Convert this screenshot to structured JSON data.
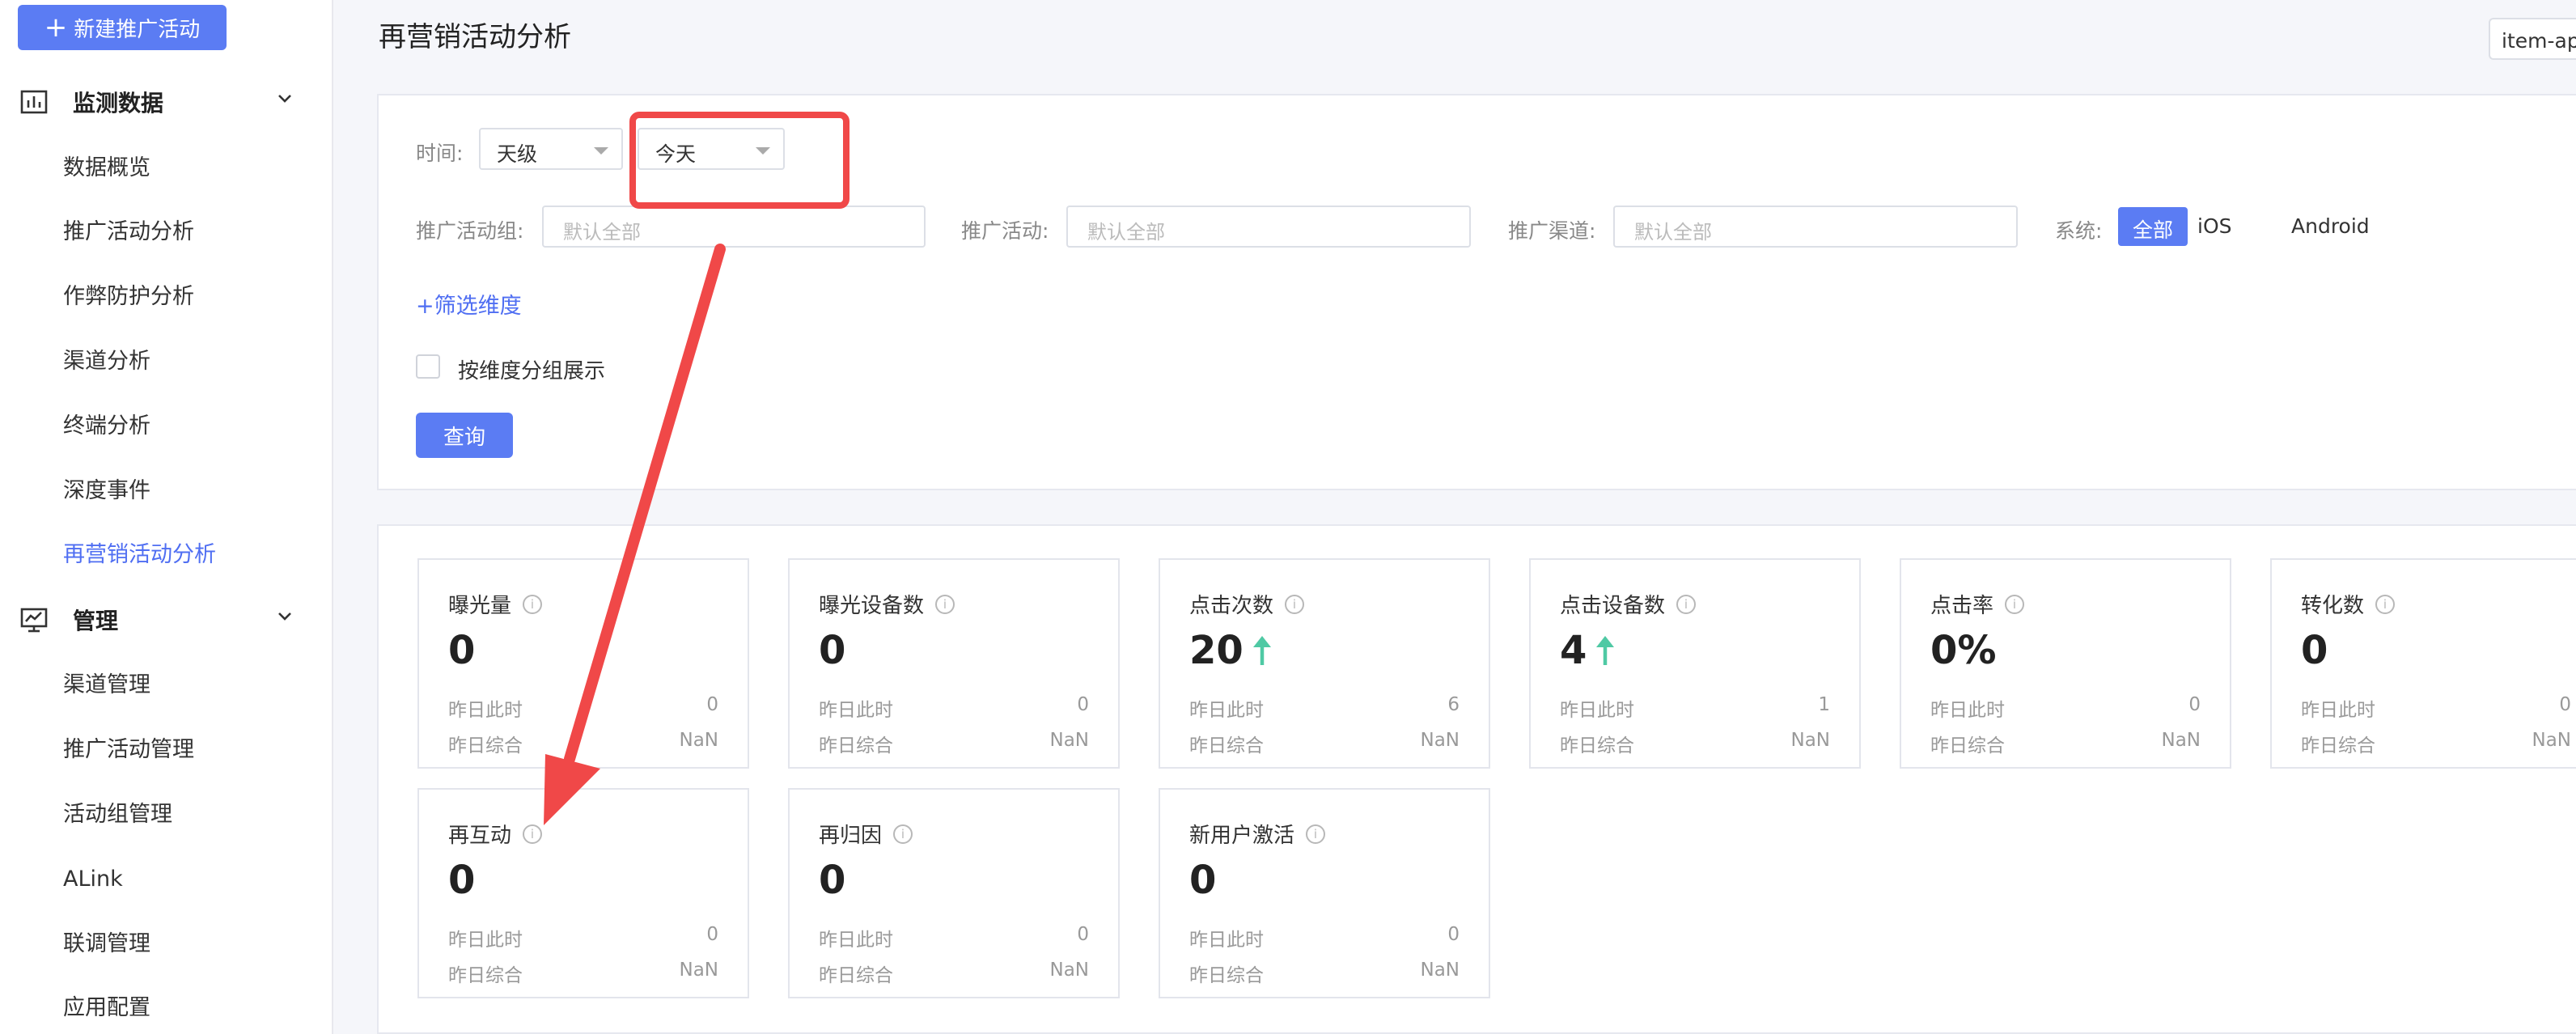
{
  "sidebar": {
    "new_button": "新建推广活动",
    "groups": [
      {
        "label": "监测数据",
        "items": [
          "数据概览",
          "推广活动分析",
          "作弊防护分析",
          "渠道分析",
          "终端分析",
          "深度事件",
          "再营销活动分析"
        ]
      },
      {
        "label": "管理",
        "items": [
          "渠道管理",
          "推广活动管理",
          "活动组管理",
          "ALink",
          "联调管理",
          "应用配置"
        ]
      }
    ],
    "active_item": "再营销活动分析"
  },
  "header": {
    "title": "再营销活动分析",
    "app_select": "item-app"
  },
  "filters": {
    "time_label": "时间:",
    "granularity": "天级",
    "date_range": "今天",
    "campaign_group_label": "推广活动组:",
    "campaign_group_placeholder": "默认全部",
    "campaign_label": "推广活动:",
    "campaign_placeholder": "默认全部",
    "channel_label": "推广渠道:",
    "channel_placeholder": "默认全部",
    "system_label": "系统:",
    "system_options": [
      "全部",
      "iOS",
      "Android"
    ],
    "system_selected": "全部",
    "add_dimension": "+筛选维度",
    "group_by_label": "按维度分组展示",
    "query_button": "查询"
  },
  "metrics": [
    {
      "title": "曝光量",
      "value": "0",
      "trend": "",
      "yesterday_label": "昨日此时",
      "yesterday_value": "0",
      "overall_label": "昨日综合",
      "overall_value": "NaN"
    },
    {
      "title": "曝光设备数",
      "value": "0",
      "trend": "",
      "yesterday_label": "昨日此时",
      "yesterday_value": "0",
      "overall_label": "昨日综合",
      "overall_value": "NaN"
    },
    {
      "title": "点击次数",
      "value": "20",
      "trend": "up",
      "yesterday_label": "昨日此时",
      "yesterday_value": "6",
      "overall_label": "昨日综合",
      "overall_value": "NaN"
    },
    {
      "title": "点击设备数",
      "value": "4",
      "trend": "up",
      "yesterday_label": "昨日此时",
      "yesterday_value": "1",
      "overall_label": "昨日综合",
      "overall_value": "NaN"
    },
    {
      "title": "点击率",
      "value": "0%",
      "trend": "",
      "yesterday_label": "昨日此时",
      "yesterday_value": "0",
      "overall_label": "昨日综合",
      "overall_value": "NaN"
    },
    {
      "title": "转化数",
      "value": "0",
      "trend": "",
      "yesterday_label": "昨日此时",
      "yesterday_value": "0",
      "overall_label": "昨日综合",
      "overall_value": "NaN"
    },
    {
      "title": "再互动",
      "value": "0",
      "trend": "",
      "yesterday_label": "昨日此时",
      "yesterday_value": "0",
      "overall_label": "昨日综合",
      "overall_value": "NaN"
    },
    {
      "title": "再归因",
      "value": "0",
      "trend": "",
      "yesterday_label": "昨日此时",
      "yesterday_value": "0",
      "overall_label": "昨日综合",
      "overall_value": "NaN"
    },
    {
      "title": "新用户激活",
      "value": "0",
      "trend": "",
      "yesterday_label": "昨日此时",
      "yesterday_value": "0",
      "overall_label": "昨日综合",
      "overall_value": "NaN"
    }
  ],
  "colors": {
    "accent": "#5b7cf3",
    "active_nav": "#4f6ef2",
    "trend_up": "#4fc9a4",
    "annotation": "#f04848"
  },
  "icons": {
    "monitor_group": "chart-bar-icon",
    "manage_group": "monitor-chart-icon",
    "info": "info-icon"
  }
}
